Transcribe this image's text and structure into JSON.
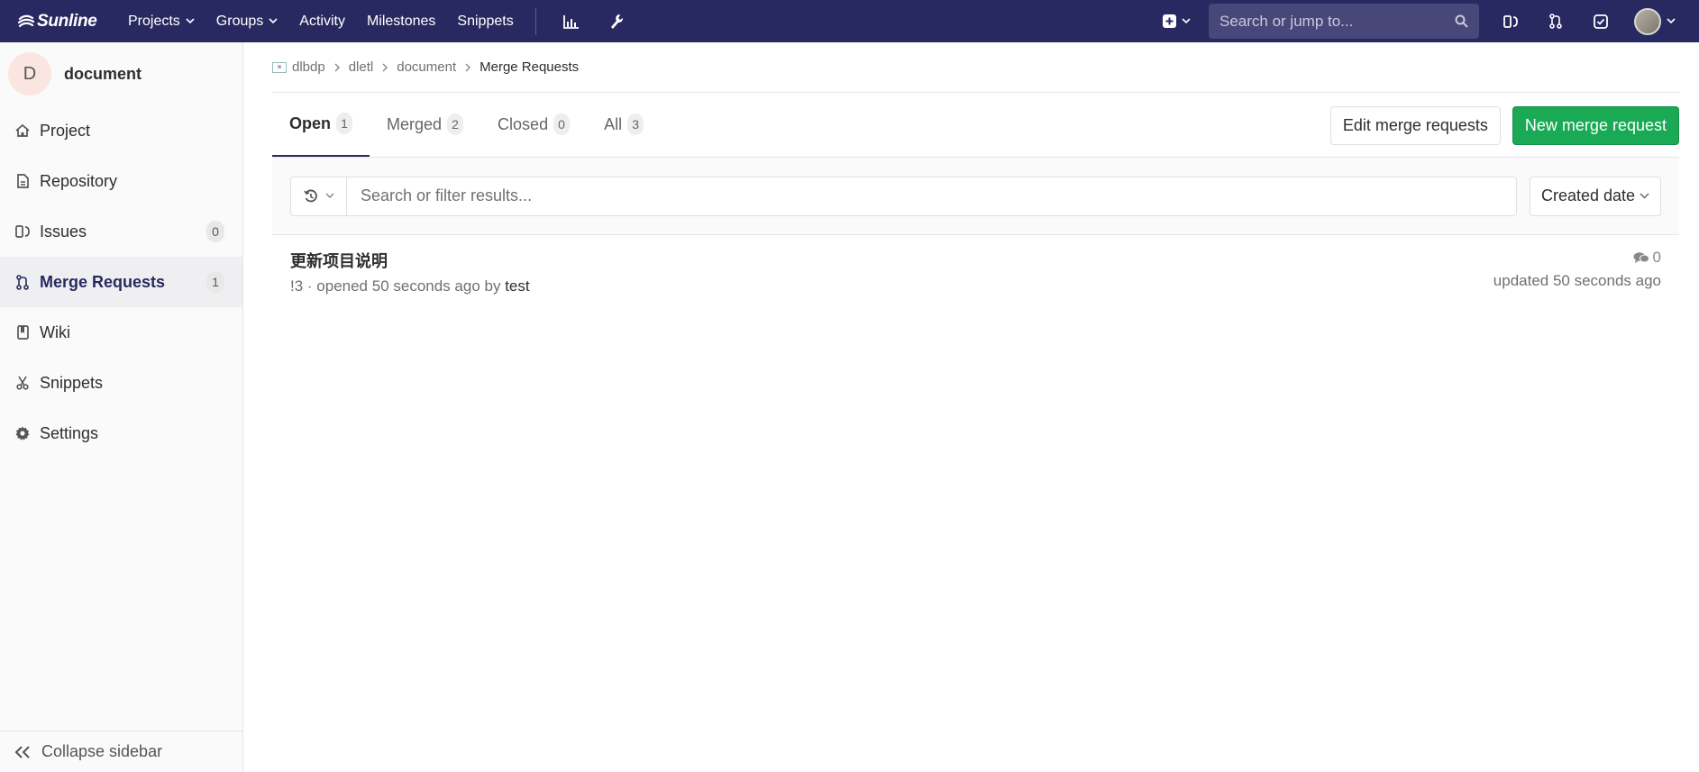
{
  "navbar": {
    "brand": "Sunline",
    "links": [
      {
        "label": "Projects",
        "dropdown": true
      },
      {
        "label": "Groups",
        "dropdown": true
      },
      {
        "label": "Activity",
        "dropdown": false
      },
      {
        "label": "Milestones",
        "dropdown": false
      },
      {
        "label": "Snippets",
        "dropdown": false
      }
    ],
    "search_placeholder": "Search or jump to...",
    "colors": {
      "bg": "#292961",
      "search_bg": "#47477a"
    }
  },
  "sidebar": {
    "project_initial": "D",
    "project_name": "document",
    "items": [
      {
        "label": "Project",
        "icon": "home-icon"
      },
      {
        "label": "Repository",
        "icon": "file-icon"
      },
      {
        "label": "Issues",
        "icon": "issues-icon",
        "count": "0"
      },
      {
        "label": "Merge Requests",
        "icon": "merge-request-icon",
        "count": "1",
        "active": true
      },
      {
        "label": "Wiki",
        "icon": "book-icon"
      },
      {
        "label": "Snippets",
        "icon": "scissors-icon"
      },
      {
        "label": "Settings",
        "icon": "gear-icon"
      }
    ],
    "collapse_label": "Collapse sidebar"
  },
  "breadcrumb": {
    "items": [
      "dlbdp",
      "dletl",
      "document"
    ],
    "current": "Merge Requests"
  },
  "tabs": [
    {
      "label": "Open",
      "count": "1",
      "active": true
    },
    {
      "label": "Merged",
      "count": "2"
    },
    {
      "label": "Closed",
      "count": "0"
    },
    {
      "label": "All",
      "count": "3"
    }
  ],
  "actions": {
    "edit_label": "Edit merge requests",
    "new_label": "New merge request",
    "success_color": "#1aaa55"
  },
  "filter": {
    "placeholder": "Search or filter results...",
    "sort_label": "Created date"
  },
  "merge_requests": [
    {
      "title": "更新项目说明",
      "meta_prefix": "!3 · opened 50 seconds ago by ",
      "author": "test",
      "comments": "0",
      "updated": "updated 50 seconds ago"
    }
  ]
}
